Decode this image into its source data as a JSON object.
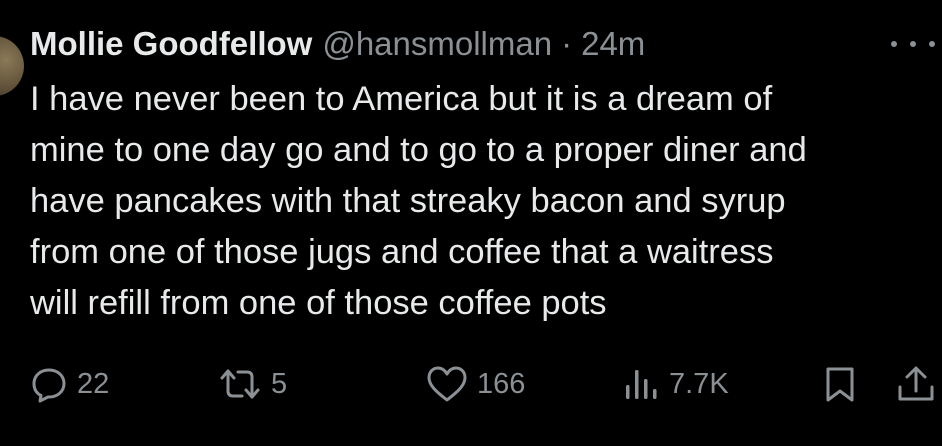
{
  "tweet": {
    "author_name": "Mollie Goodfellow",
    "handle": "@hansmollman",
    "separator": "·",
    "time": "24m",
    "lines": [
      "I have never been to America but it is a dream of",
      "mine to one day go and to go to a proper diner and",
      "have pancakes with that streaky bacon and syrup",
      "from one of those jugs and coffee that a waitress",
      "will refill from one of those coffee pots"
    ]
  },
  "actions": {
    "replies": "22",
    "reposts": "5",
    "likes": "166",
    "views": "7.7K"
  },
  "icons": {
    "more": "more-horizontal-icon",
    "reply": "reply-icon",
    "repost": "repost-icon",
    "like": "heart-icon",
    "views": "views-icon",
    "bookmark": "bookmark-icon",
    "share": "share-icon"
  },
  "colors": {
    "background": "#000000",
    "text": "#e7e9ea",
    "muted": "#8b9095"
  }
}
